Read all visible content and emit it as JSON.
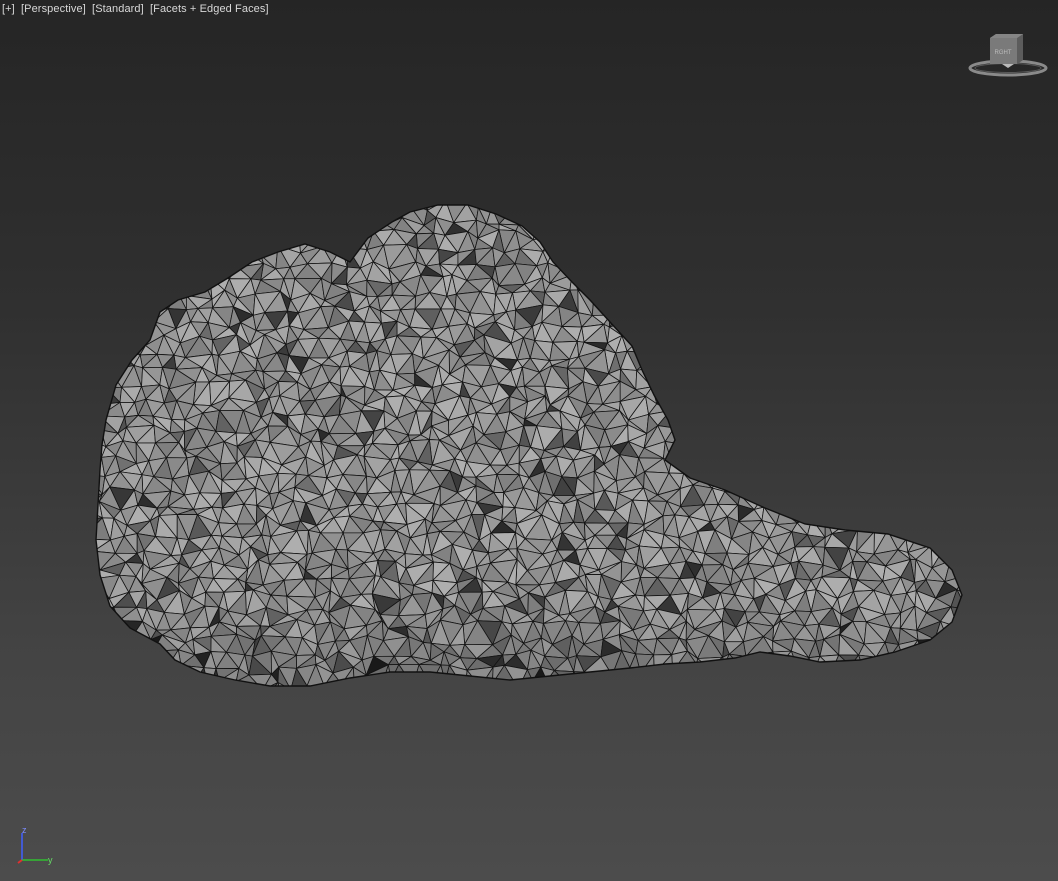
{
  "viewport": {
    "menu_label": "[+]",
    "view_label": "[Perspective]",
    "shading_label": "[Standard]",
    "display_label": "[Facets + Edged Faces]"
  },
  "viewcube": {
    "face_label": "RGHT",
    "icon": "viewcube-icon"
  },
  "axis_gizmo": {
    "z_label": "z",
    "y_label": "y",
    "x_color": "#e03030",
    "y_color": "#30c030",
    "z_color": "#4060ff"
  },
  "mesh": {
    "display_mode": "Facets + Edged Faces",
    "face_color": "#a8a8a8",
    "edge_color": "#141414"
  }
}
